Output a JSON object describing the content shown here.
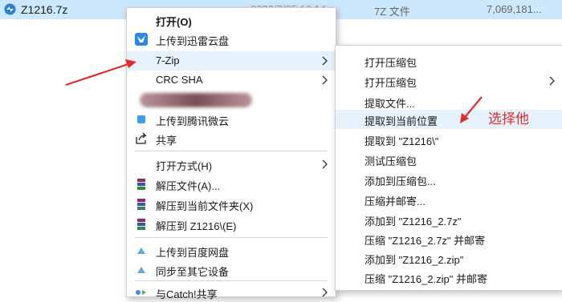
{
  "file": {
    "name": "Z1216.7z",
    "date": "2023/7/25 16:14",
    "type": "7Z 文件",
    "size": "7,069,181..."
  },
  "menu": {
    "open": "打开(O)",
    "xunlei": "上传到迅雷云盘",
    "sevenzip": "7-Zip",
    "crc": "CRC SHA",
    "tencent": "上传到腾讯微云",
    "share": "共享",
    "open_with": "打开方式(H)",
    "extract_files": "解压文件(A)...",
    "extract_here": "解压到当前文件夹(X)",
    "extract_to": "解压到 Z1216\\(E)",
    "baidu": "上传到百度网盘",
    "sync": "同步至其它设备",
    "catch": "与Catch!共享"
  },
  "submenu": [
    "打开压缩包",
    "打开压缩包",
    "提取文件...",
    "提取到当前位置",
    "提取到 \"Z1216\\\"",
    "测试压缩包",
    "添加到压缩包...",
    "压缩并邮寄...",
    "添加到 \"Z1216_2.7z\"",
    "压缩 \"Z1216_2.7z\" 并邮寄",
    "添加到 \"Z1216_2.zip\"",
    "压缩 \"Z1216_2.zip\" 并邮寄"
  ],
  "annotation": "选择他",
  "colors": {
    "selection": "#cce8ff",
    "hover": "#e5f1fb",
    "annotation": "#e32b2b"
  }
}
